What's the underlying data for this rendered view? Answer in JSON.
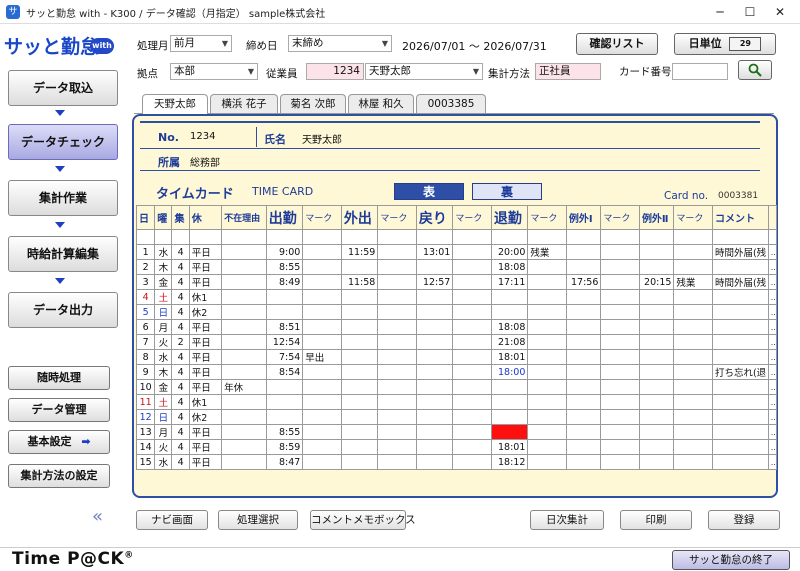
{
  "window": {
    "title": "サッと勤怠 with - K300 / データ確認（月指定）  sample株式会社",
    "app_icon": "サ",
    "minimize": "─",
    "maximize": "☐",
    "close": "✕"
  },
  "sidebar": {
    "logo": "サッと勤怠",
    "logo_badge": "with",
    "nav": [
      {
        "label": "データ取込"
      },
      {
        "label": "データチェック"
      },
      {
        "label": "集計作業"
      },
      {
        "label": "時給計算編集"
      },
      {
        "label": "データ出力"
      }
    ],
    "actions": [
      {
        "label": "随時処理"
      },
      {
        "label": "データ管理"
      },
      {
        "label": "基本設定",
        "arrow": "➡"
      },
      {
        "label": "集計方法の設定"
      }
    ],
    "collapse": "«"
  },
  "filters": {
    "period_label": "処理月",
    "period_value": "前月",
    "closing_label": "締め日",
    "closing_value": "末締め",
    "date_range": "2026/07/01 ～ 2026/07/31",
    "confirm_list": "確認リスト",
    "daily_unit": "日単位",
    "site_label": "拠点",
    "site_value": "本部",
    "employee_label": "従業員",
    "employee_code": "1234",
    "employee_name": "天野太郎",
    "method_label": "集計方法",
    "method_value": "正社員",
    "card_label": "カード番号",
    "card_value": ""
  },
  "tabs": [
    "天野太郎",
    "横浜 花子",
    "菊名 次郎",
    "林屋 和久",
    "0003385"
  ],
  "card": {
    "no_label": "No.",
    "no_value": "1234",
    "name_label": "氏名",
    "name_value": "天野太郎",
    "dept_label": "所属",
    "dept_value": "総務部",
    "title_jp": "タイムカード",
    "title_en": "TIME CARD",
    "front": "表",
    "back": "裏",
    "card_no_label": "Card no.",
    "card_no_value": "0003381"
  },
  "table": {
    "headers": {
      "day": "日",
      "dow": "曜",
      "shift": "集",
      "rest": "休",
      "reason": "不在理由",
      "in": "出勤",
      "out_break": "外出",
      "back": "戻り",
      "leave": "退勤",
      "ex1": "例外Ⅰ",
      "ex2": "例外Ⅱ",
      "comment": "コメント",
      "mark": "マーク"
    },
    "rows": [
      {
        "d": "",
        "w": "",
        "s": "",
        "k": "",
        "r": "",
        "in": "",
        "inm": "",
        "out": "",
        "outm": "",
        "bk": "",
        "bkm": "",
        "lv": "",
        "lvm": "",
        "e1": "",
        "e1m": "",
        "e2": "",
        "e2m": "",
        "c": ""
      },
      {
        "d": "1",
        "w": "水",
        "s": "4",
        "k": "平日",
        "r": "",
        "in": "9:00",
        "inm": "",
        "out": "11:59",
        "outm": "",
        "bk": "13:01",
        "bkm": "",
        "lv": "20:00",
        "lvm": "残業",
        "e1": "",
        "e1m": "",
        "e2": "",
        "e2m": "",
        "c": "時間外届(残"
      },
      {
        "d": "2",
        "w": "木",
        "s": "4",
        "k": "平日",
        "r": "",
        "in": "8:55",
        "inm": "",
        "out": "",
        "outm": "",
        "bk": "",
        "bkm": "",
        "lv": "18:08",
        "lvm": "",
        "e1": "",
        "e1m": "",
        "e2": "",
        "e2m": "",
        "c": ""
      },
      {
        "d": "3",
        "w": "金",
        "s": "4",
        "k": "平日",
        "r": "",
        "in": "8:49",
        "inm": "",
        "out": "11:58",
        "outm": "",
        "bk": "12:57",
        "bkm": "",
        "lv": "17:11",
        "lvm": "",
        "e1": "17:56",
        "e1m": "",
        "e2": "20:15",
        "e2m": "残業",
        "c": "時間外届(残"
      },
      {
        "d": "4",
        "w": "土",
        "s": "4",
        "k": "休1",
        "r": "",
        "in": "",
        "inm": "",
        "out": "",
        "outm": "",
        "bk": "",
        "bkm": "",
        "lv": "",
        "lvm": "",
        "e1": "",
        "e1m": "",
        "e2": "",
        "e2m": "",
        "c": ""
      },
      {
        "d": "5",
        "w": "日",
        "s": "4",
        "k": "休2",
        "r": "",
        "in": "",
        "inm": "",
        "out": "",
        "outm": "",
        "bk": "",
        "bkm": "",
        "lv": "",
        "lvm": "",
        "e1": "",
        "e1m": "",
        "e2": "",
        "e2m": "",
        "c": ""
      },
      {
        "d": "6",
        "w": "月",
        "s": "4",
        "k": "平日",
        "r": "",
        "in": "8:51",
        "inm": "",
        "out": "",
        "outm": "",
        "bk": "",
        "bkm": "",
        "lv": "18:08",
        "lvm": "",
        "e1": "",
        "e1m": "",
        "e2": "",
        "e2m": "",
        "c": ""
      },
      {
        "d": "7",
        "w": "火",
        "s": "2",
        "k": "平日",
        "r": "",
        "in": "12:54",
        "inm": "",
        "out": "",
        "outm": "",
        "bk": "",
        "bkm": "",
        "lv": "21:08",
        "lvm": "",
        "e1": "",
        "e1m": "",
        "e2": "",
        "e2m": "",
        "c": ""
      },
      {
        "d": "8",
        "w": "水",
        "s": "4",
        "k": "平日",
        "r": "",
        "in": "7:54",
        "inm": "早出",
        "out": "",
        "outm": "",
        "bk": "",
        "bkm": "",
        "lv": "18:01",
        "lvm": "",
        "e1": "",
        "e1m": "",
        "e2": "",
        "e2m": "",
        "c": ""
      },
      {
        "d": "9",
        "w": "木",
        "s": "4",
        "k": "平日",
        "r": "",
        "in": "8:54",
        "inm": "",
        "out": "",
        "outm": "",
        "bk": "",
        "bkm": "",
        "lv": "18:00",
        "lvm": "",
        "e1": "",
        "e1m": "",
        "e2": "",
        "e2m": "",
        "c": "打ち忘れ(退"
      },
      {
        "d": "10",
        "w": "金",
        "s": "4",
        "k": "平日",
        "r": "年休",
        "in": "",
        "inm": "",
        "out": "",
        "outm": "",
        "bk": "",
        "bkm": "",
        "lv": "",
        "lvm": "",
        "e1": "",
        "e1m": "",
        "e2": "",
        "e2m": "",
        "c": ""
      },
      {
        "d": "11",
        "w": "土",
        "s": "4",
        "k": "休1",
        "r": "",
        "in": "",
        "inm": "",
        "out": "",
        "outm": "",
        "bk": "",
        "bkm": "",
        "lv": "",
        "lvm": "",
        "e1": "",
        "e1m": "",
        "e2": "",
        "e2m": "",
        "c": ""
      },
      {
        "d": "12",
        "w": "日",
        "s": "4",
        "k": "休2",
        "r": "",
        "in": "",
        "inm": "",
        "out": "",
        "outm": "",
        "bk": "",
        "bkm": "",
        "lv": "",
        "lvm": "",
        "e1": "",
        "e1m": "",
        "e2": "",
        "e2m": "",
        "c": ""
      },
      {
        "d": "13",
        "w": "月",
        "s": "4",
        "k": "平日",
        "r": "",
        "in": "8:55",
        "inm": "",
        "out": "",
        "outm": "",
        "bk": "",
        "bkm": "",
        "lv": "",
        "lvm": "",
        "e1": "",
        "e1m": "",
        "e2": "",
        "e2m": "",
        "c": ""
      },
      {
        "d": "14",
        "w": "火",
        "s": "4",
        "k": "平日",
        "r": "",
        "in": "8:59",
        "inm": "",
        "out": "",
        "outm": "",
        "bk": "",
        "bkm": "",
        "lv": "18:01",
        "lvm": "",
        "e1": "",
        "e1m": "",
        "e2": "",
        "e2m": "",
        "c": ""
      },
      {
        "d": "15",
        "w": "水",
        "s": "4",
        "k": "平日",
        "r": "",
        "in": "8:47",
        "inm": "",
        "out": "",
        "outm": "",
        "bk": "",
        "bkm": "",
        "lv": "18:12",
        "lvm": "",
        "e1": "",
        "e1m": "",
        "e2": "",
        "e2m": "",
        "c": ""
      }
    ],
    "more_glyph": "...",
    "missing_color": "#ff1010"
  },
  "bottom": {
    "nav_screen": "ナビ画面",
    "process_select": "処理選択",
    "comment_memo": "コメントメモボックス",
    "daily_total": "日次集計",
    "print": "印刷",
    "register": "登録",
    "brand": "Time P@CK",
    "brand_mark": "®",
    "exit": "サッと勤怠の終了"
  },
  "colors": {
    "accent": "#2d4fa6",
    "card_bg": "#fff8d6",
    "saturday": "#d01010",
    "sunday": "#1a3ac8"
  }
}
